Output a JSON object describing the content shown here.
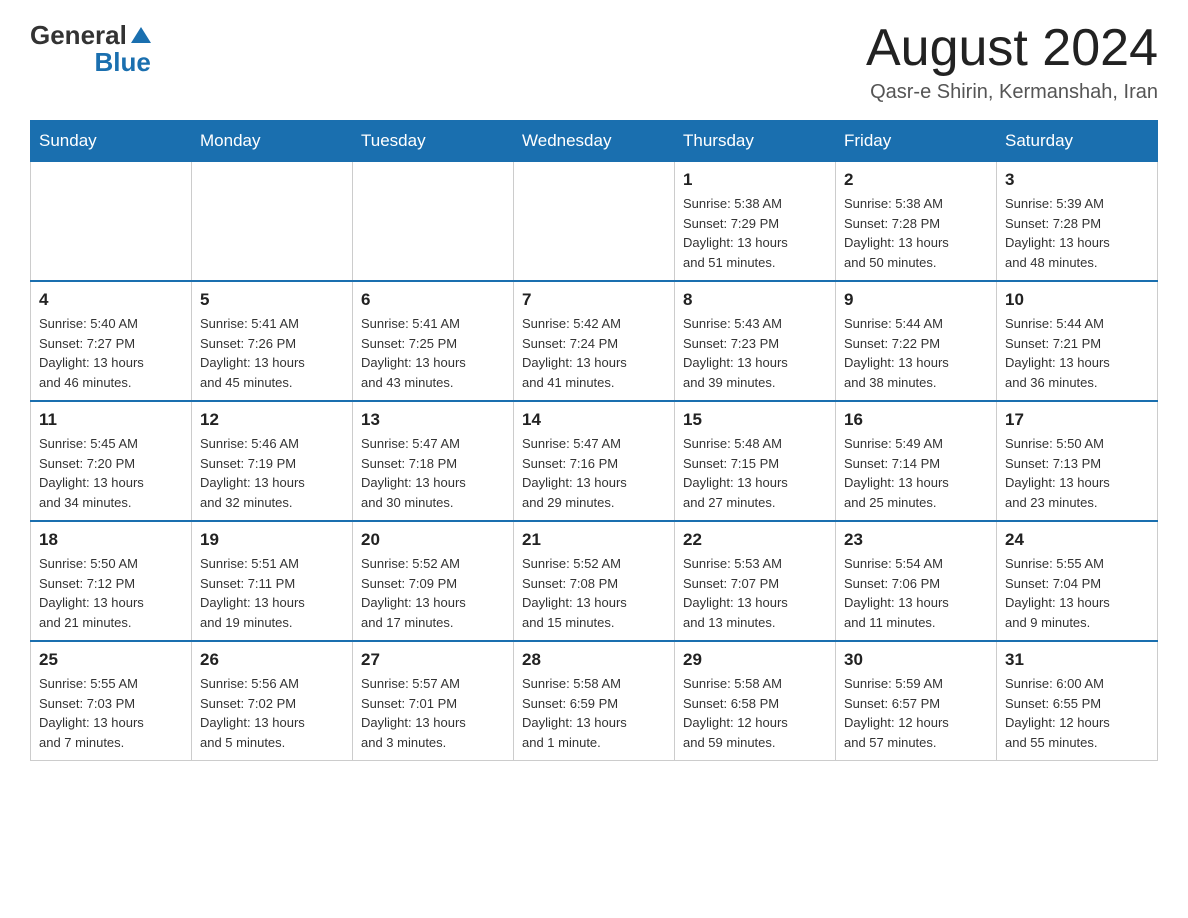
{
  "logo": {
    "text_general": "General",
    "text_blue": "Blue"
  },
  "header": {
    "month": "August 2024",
    "location": "Qasr-e Shirin, Kermanshah, Iran"
  },
  "days_of_week": [
    "Sunday",
    "Monday",
    "Tuesday",
    "Wednesday",
    "Thursday",
    "Friday",
    "Saturday"
  ],
  "weeks": [
    [
      {
        "num": "",
        "info": ""
      },
      {
        "num": "",
        "info": ""
      },
      {
        "num": "",
        "info": ""
      },
      {
        "num": "",
        "info": ""
      },
      {
        "num": "1",
        "info": "Sunrise: 5:38 AM\nSunset: 7:29 PM\nDaylight: 13 hours\nand 51 minutes."
      },
      {
        "num": "2",
        "info": "Sunrise: 5:38 AM\nSunset: 7:28 PM\nDaylight: 13 hours\nand 50 minutes."
      },
      {
        "num": "3",
        "info": "Sunrise: 5:39 AM\nSunset: 7:28 PM\nDaylight: 13 hours\nand 48 minutes."
      }
    ],
    [
      {
        "num": "4",
        "info": "Sunrise: 5:40 AM\nSunset: 7:27 PM\nDaylight: 13 hours\nand 46 minutes."
      },
      {
        "num": "5",
        "info": "Sunrise: 5:41 AM\nSunset: 7:26 PM\nDaylight: 13 hours\nand 45 minutes."
      },
      {
        "num": "6",
        "info": "Sunrise: 5:41 AM\nSunset: 7:25 PM\nDaylight: 13 hours\nand 43 minutes."
      },
      {
        "num": "7",
        "info": "Sunrise: 5:42 AM\nSunset: 7:24 PM\nDaylight: 13 hours\nand 41 minutes."
      },
      {
        "num": "8",
        "info": "Sunrise: 5:43 AM\nSunset: 7:23 PM\nDaylight: 13 hours\nand 39 minutes."
      },
      {
        "num": "9",
        "info": "Sunrise: 5:44 AM\nSunset: 7:22 PM\nDaylight: 13 hours\nand 38 minutes."
      },
      {
        "num": "10",
        "info": "Sunrise: 5:44 AM\nSunset: 7:21 PM\nDaylight: 13 hours\nand 36 minutes."
      }
    ],
    [
      {
        "num": "11",
        "info": "Sunrise: 5:45 AM\nSunset: 7:20 PM\nDaylight: 13 hours\nand 34 minutes."
      },
      {
        "num": "12",
        "info": "Sunrise: 5:46 AM\nSunset: 7:19 PM\nDaylight: 13 hours\nand 32 minutes."
      },
      {
        "num": "13",
        "info": "Sunrise: 5:47 AM\nSunset: 7:18 PM\nDaylight: 13 hours\nand 30 minutes."
      },
      {
        "num": "14",
        "info": "Sunrise: 5:47 AM\nSunset: 7:16 PM\nDaylight: 13 hours\nand 29 minutes."
      },
      {
        "num": "15",
        "info": "Sunrise: 5:48 AM\nSunset: 7:15 PM\nDaylight: 13 hours\nand 27 minutes."
      },
      {
        "num": "16",
        "info": "Sunrise: 5:49 AM\nSunset: 7:14 PM\nDaylight: 13 hours\nand 25 minutes."
      },
      {
        "num": "17",
        "info": "Sunrise: 5:50 AM\nSunset: 7:13 PM\nDaylight: 13 hours\nand 23 minutes."
      }
    ],
    [
      {
        "num": "18",
        "info": "Sunrise: 5:50 AM\nSunset: 7:12 PM\nDaylight: 13 hours\nand 21 minutes."
      },
      {
        "num": "19",
        "info": "Sunrise: 5:51 AM\nSunset: 7:11 PM\nDaylight: 13 hours\nand 19 minutes."
      },
      {
        "num": "20",
        "info": "Sunrise: 5:52 AM\nSunset: 7:09 PM\nDaylight: 13 hours\nand 17 minutes."
      },
      {
        "num": "21",
        "info": "Sunrise: 5:52 AM\nSunset: 7:08 PM\nDaylight: 13 hours\nand 15 minutes."
      },
      {
        "num": "22",
        "info": "Sunrise: 5:53 AM\nSunset: 7:07 PM\nDaylight: 13 hours\nand 13 minutes."
      },
      {
        "num": "23",
        "info": "Sunrise: 5:54 AM\nSunset: 7:06 PM\nDaylight: 13 hours\nand 11 minutes."
      },
      {
        "num": "24",
        "info": "Sunrise: 5:55 AM\nSunset: 7:04 PM\nDaylight: 13 hours\nand 9 minutes."
      }
    ],
    [
      {
        "num": "25",
        "info": "Sunrise: 5:55 AM\nSunset: 7:03 PM\nDaylight: 13 hours\nand 7 minutes."
      },
      {
        "num": "26",
        "info": "Sunrise: 5:56 AM\nSunset: 7:02 PM\nDaylight: 13 hours\nand 5 minutes."
      },
      {
        "num": "27",
        "info": "Sunrise: 5:57 AM\nSunset: 7:01 PM\nDaylight: 13 hours\nand 3 minutes."
      },
      {
        "num": "28",
        "info": "Sunrise: 5:58 AM\nSunset: 6:59 PM\nDaylight: 13 hours\nand 1 minute."
      },
      {
        "num": "29",
        "info": "Sunrise: 5:58 AM\nSunset: 6:58 PM\nDaylight: 12 hours\nand 59 minutes."
      },
      {
        "num": "30",
        "info": "Sunrise: 5:59 AM\nSunset: 6:57 PM\nDaylight: 12 hours\nand 57 minutes."
      },
      {
        "num": "31",
        "info": "Sunrise: 6:00 AM\nSunset: 6:55 PM\nDaylight: 12 hours\nand 55 minutes."
      }
    ]
  ]
}
